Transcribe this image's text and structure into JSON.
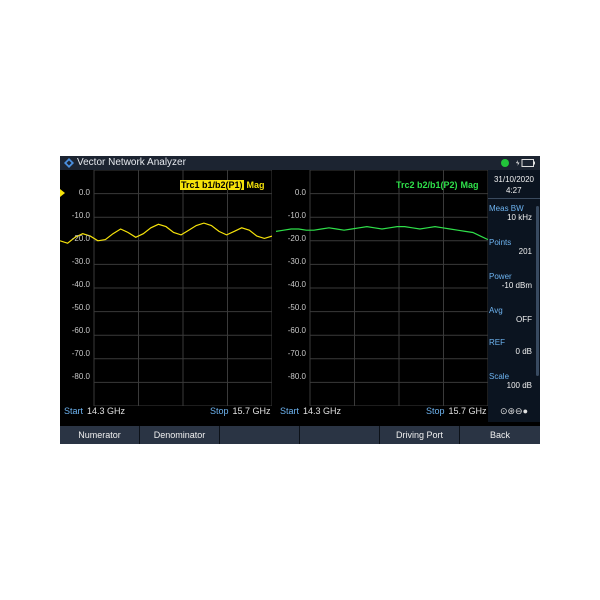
{
  "app": {
    "title": "Vector Network Analyzer"
  },
  "panels": [
    {
      "trace_name": "Trc1 b1/b2(P1)",
      "format": "Mag",
      "trace_color": "#f5e20a",
      "y_labels": [
        "0.0",
        "-10.0",
        "-20.0",
        "-30.0",
        "-40.0",
        "-50.0",
        "-60.0",
        "-70.0",
        "-80.0"
      ],
      "start_label": "Start",
      "start_value": "14.3 GHz",
      "stop_label": "Stop",
      "stop_value": "15.7 GHz"
    },
    {
      "trace_name": "Trc2 b2/b1(P2)",
      "format": "Mag",
      "trace_color": "#2fe04a",
      "y_labels": [
        "0.0",
        "-10.0",
        "-20.0",
        "-30.0",
        "-40.0",
        "-50.0",
        "-60.0",
        "-70.0",
        "-80.0"
      ],
      "start_label": "Start",
      "start_value": "14.3 GHz",
      "stop_label": "Stop",
      "stop_value": "15.7 GHz"
    }
  ],
  "sidebar": {
    "date": "31/10/2020",
    "time": "4:27",
    "items": [
      {
        "label": "Meas BW",
        "value": "10 kHz"
      },
      {
        "label": "Points",
        "value": "201"
      },
      {
        "label": "Power",
        "value": "-10 dBm"
      },
      {
        "label": "Avg",
        "value": "OFF"
      },
      {
        "label": "REF",
        "value": "0 dB"
      },
      {
        "label": "Scale",
        "value": "100 dB"
      }
    ],
    "bottom_icons": "⊙⊛⊖●"
  },
  "softkeys": [
    "Numerator",
    "Denominator",
    "",
    "",
    "Driving Port",
    "Back"
  ],
  "chart_data": [
    {
      "type": "line",
      "title": "Trc1 b1/b2(P1) Mag",
      "xlabel": "",
      "ylabel": "",
      "xlim": [
        14.3,
        15.7
      ],
      "ylim": [
        -90,
        10
      ],
      "series": [
        {
          "name": "Trc1 b1/b2(P1)",
          "x": [
            14.3,
            14.35,
            14.4,
            14.45,
            14.5,
            14.55,
            14.6,
            14.65,
            14.7,
            14.75,
            14.8,
            14.85,
            14.9,
            14.95,
            15.0,
            15.05,
            15.1,
            15.15,
            15.2,
            15.25,
            15.3,
            15.35,
            15.4,
            15.45,
            15.5,
            15.55,
            15.6,
            15.65,
            15.7
          ],
          "y": [
            -20.0,
            -21.0,
            -18.5,
            -17.0,
            -18.0,
            -20.0,
            -19.5,
            -17.0,
            -15.0,
            -16.5,
            -18.5,
            -17.0,
            -14.5,
            -13.0,
            -14.0,
            -16.5,
            -17.5,
            -15.5,
            -13.5,
            -12.5,
            -13.5,
            -16.0,
            -17.5,
            -16.0,
            -14.5,
            -15.5,
            -18.0,
            -19.0,
            -18.0
          ]
        }
      ]
    },
    {
      "type": "line",
      "title": "Trc2 b2/b1(P2) Mag",
      "xlabel": "",
      "ylabel": "",
      "xlim": [
        14.3,
        15.7
      ],
      "ylim": [
        -90,
        10
      ],
      "series": [
        {
          "name": "Trc2 b2/b1(P2)",
          "x": [
            14.3,
            14.35,
            14.4,
            14.45,
            14.5,
            14.55,
            14.6,
            14.65,
            14.7,
            14.75,
            14.8,
            14.85,
            14.9,
            14.95,
            15.0,
            15.05,
            15.1,
            15.15,
            15.2,
            15.25,
            15.3,
            15.35,
            15.4,
            15.45,
            15.5,
            15.55,
            15.6,
            15.65,
            15.7
          ],
          "y": [
            -16.0,
            -15.5,
            -15.0,
            -15.0,
            -15.5,
            -15.5,
            -15.0,
            -14.5,
            -15.0,
            -15.5,
            -15.0,
            -14.5,
            -14.0,
            -14.5,
            -15.0,
            -14.5,
            -14.0,
            -14.0,
            -14.5,
            -15.0,
            -14.5,
            -14.0,
            -14.5,
            -15.0,
            -15.5,
            -16.0,
            -16.5,
            -18.0,
            -19.5
          ]
        }
      ]
    }
  ]
}
